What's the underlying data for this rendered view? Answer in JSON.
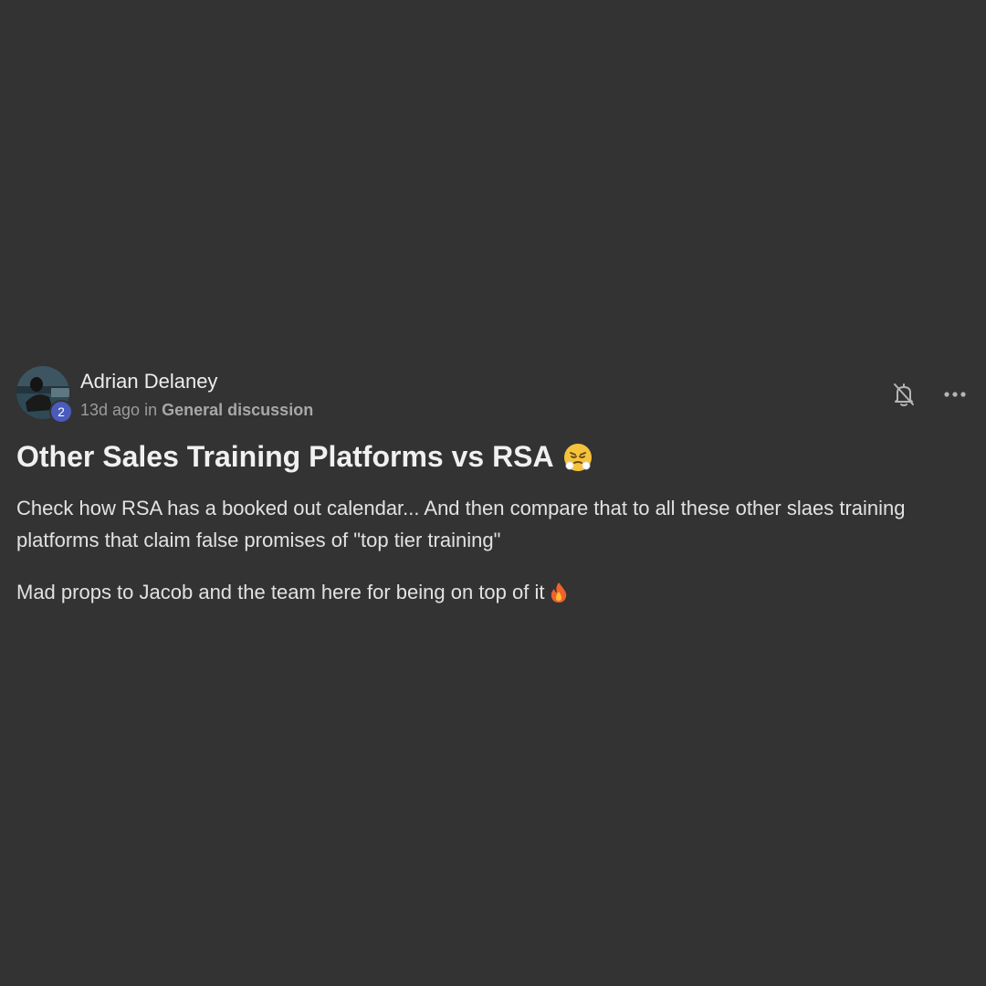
{
  "post": {
    "author": {
      "name": "Adrian Delaney",
      "level": "2"
    },
    "meta": {
      "time": "13d ago",
      "in_word": "in",
      "category": "General discussion"
    },
    "actions": {
      "notify_icon": "bell-off-icon",
      "more_icon": "more-horizontal-icon"
    },
    "title": "Other Sales Training Platforms vs RSA",
    "title_emoji": "face-with-steam-from-nose",
    "body": {
      "paragraph1": "Check how RSA has a booked out calendar... And then compare that to all these other slaes training platforms that claim false promises of \"top tier training\"",
      "paragraph2": "Mad props to Jacob and the team here for being on top of it",
      "paragraph2_emoji": "fire"
    },
    "colors": {
      "background": "#333333",
      "badge": "#4a5bbd"
    }
  }
}
